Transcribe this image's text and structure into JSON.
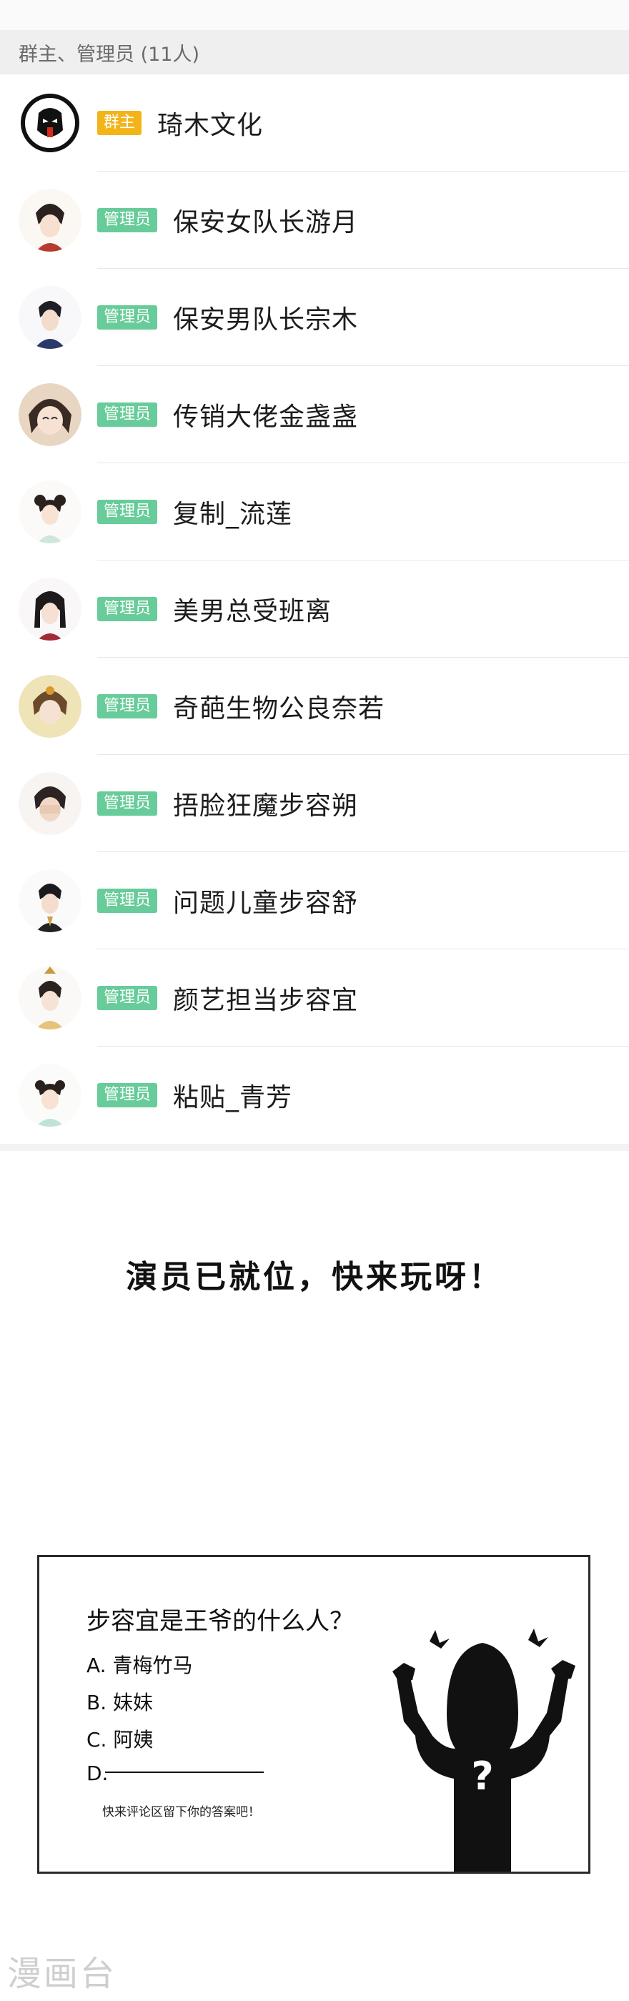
{
  "section_header": "群主、管理员 (11人)",
  "members": [
    {
      "badge": "群主",
      "name": "琦木文化",
      "role": "owner"
    },
    {
      "badge": "管理员",
      "name": "保安女队长游月",
      "role": "admin"
    },
    {
      "badge": "管理员",
      "name": "保安男队长宗木",
      "role": "admin"
    },
    {
      "badge": "管理员",
      "name": "传销大佬金盏盏",
      "role": "admin"
    },
    {
      "badge": "管理员",
      "name": "复制_流莲",
      "role": "admin"
    },
    {
      "badge": "管理员",
      "name": "美男总受班离",
      "role": "admin"
    },
    {
      "badge": "管理员",
      "name": "奇葩生物公良奈若",
      "role": "admin"
    },
    {
      "badge": "管理员",
      "name": "捂脸狂魔步容朔",
      "role": "admin"
    },
    {
      "badge": "管理员",
      "name": "问题儿童步容舒",
      "role": "admin"
    },
    {
      "badge": "管理员",
      "name": "颜艺担当步容宜",
      "role": "admin"
    },
    {
      "badge": "管理员",
      "name": "粘贴_青芳",
      "role": "admin"
    }
  ],
  "slogan": "演员已就位，快来玩呀！",
  "quiz": {
    "question": "步容宜是王爷的什么人？",
    "options": [
      "A. 青梅竹马",
      "B. 妹妹",
      "C. 阿姨",
      "D."
    ],
    "hint": "快来评论区留下你的答案吧！",
    "mystery_mark": "?"
  },
  "watermark": "漫画台",
  "colors": {
    "owner_badge": "#f3b41a",
    "admin_badge": "#68cc9a",
    "header_bg": "#efefef"
  }
}
